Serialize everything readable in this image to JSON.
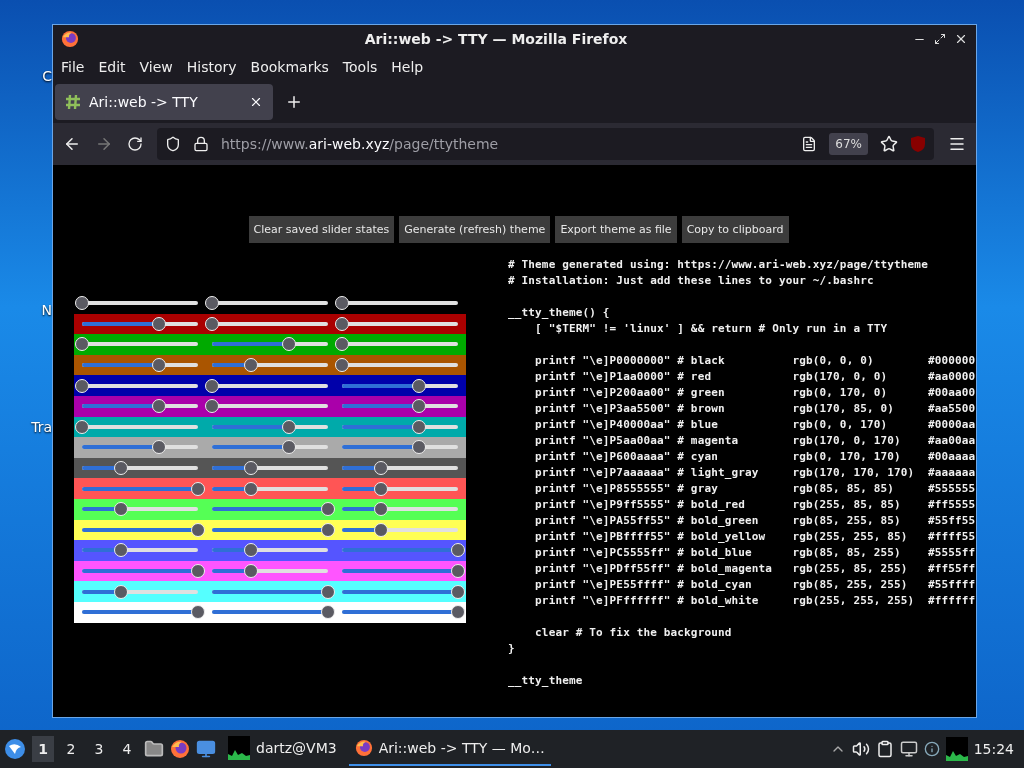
{
  "desktop_labels": [
    "C",
    "N",
    "Tra"
  ],
  "window": {
    "title": "Ari::web -> TTY — Mozilla Firefox"
  },
  "menu": [
    "File",
    "Edit",
    "View",
    "History",
    "Bookmarks",
    "Tools",
    "Help"
  ],
  "tabs": [
    {
      "label": "Ari::web -> TTY",
      "selected": true
    }
  ],
  "address": {
    "prefix": "https://www.",
    "domain": "ari-web.xyz",
    "path": "/page/ttytheme",
    "zoom": "67%"
  },
  "buttons": [
    "Clear saved slider states",
    "Generate (refresh) theme",
    "Export theme as file",
    "Copy to clipboard"
  ],
  "swatches": [
    {
      "color": "#000000",
      "sliders": [
        {
          "level": 0
        },
        {
          "level": 0
        },
        {
          "level": 0
        }
      ]
    },
    {
      "color": "#aa0000",
      "sliders": [
        {
          "level": 0.667
        },
        {
          "level": 0
        },
        {
          "level": 0
        }
      ]
    },
    {
      "color": "#00aa00",
      "sliders": [
        {
          "level": 0
        },
        {
          "level": 0.667
        },
        {
          "level": 0
        }
      ]
    },
    {
      "color": "#aa5500",
      "sliders": [
        {
          "level": 0.667
        },
        {
          "level": 0.333
        },
        {
          "level": 0
        }
      ]
    },
    {
      "color": "#0000aa",
      "sliders": [
        {
          "level": 0
        },
        {
          "level": 0
        },
        {
          "level": 0.667
        }
      ]
    },
    {
      "color": "#aa00aa",
      "sliders": [
        {
          "level": 0.667
        },
        {
          "level": 0
        },
        {
          "level": 0.667
        }
      ]
    },
    {
      "color": "#00aaaa",
      "sliders": [
        {
          "level": 0
        },
        {
          "level": 0.667
        },
        {
          "level": 0.667
        }
      ]
    },
    {
      "color": "#aaaaaa",
      "sliders": [
        {
          "level": 0.667
        },
        {
          "level": 0.667
        },
        {
          "level": 0.667
        }
      ]
    },
    {
      "color": "#555555",
      "sliders": [
        {
          "level": 0.333
        },
        {
          "level": 0.333
        },
        {
          "level": 0.333
        }
      ]
    },
    {
      "color": "#ff5555",
      "sliders": [
        {
          "level": 1
        },
        {
          "level": 0.333
        },
        {
          "level": 0.333
        }
      ]
    },
    {
      "color": "#55ff55",
      "sliders": [
        {
          "level": 0.333
        },
        {
          "level": 1
        },
        {
          "level": 0.333
        }
      ]
    },
    {
      "color": "#ffff55",
      "sliders": [
        {
          "level": 1
        },
        {
          "level": 1
        },
        {
          "level": 0.333
        }
      ]
    },
    {
      "color": "#5555ff",
      "sliders": [
        {
          "level": 0.333
        },
        {
          "level": 0.333
        },
        {
          "level": 1
        }
      ]
    },
    {
      "color": "#ff55ff",
      "sliders": [
        {
          "level": 1
        },
        {
          "level": 0.333
        },
        {
          "level": 1
        }
      ]
    },
    {
      "color": "#55ffff",
      "sliders": [
        {
          "level": 0.333
        },
        {
          "level": 1
        },
        {
          "level": 1
        }
      ]
    },
    {
      "color": "#ffffff",
      "sliders": [
        {
          "level": 1
        },
        {
          "level": 1
        },
        {
          "level": 1
        }
      ]
    }
  ],
  "code_blocks": [
    [
      "# Theme generated using: https://www.ari-web.xyz/page/ttytheme",
      "# Installation: Just add these lines to your ~/.bashrc"
    ],
    [
      "__tty_theme() {",
      "    [ \"$TERM\" != 'linux' ] && return # Only run in a TTY"
    ],
    [
      "    printf \"\\e]P0000000\" # black          rgb(0, 0, 0)        #000000",
      "    printf \"\\e]P1aa0000\" # red            rgb(170, 0, 0)      #aa0000",
      "    printf \"\\e]P200aa00\" # green          rgb(0, 170, 0)      #00aa00",
      "    printf \"\\e]P3aa5500\" # brown          rgb(170, 85, 0)     #aa5500",
      "    printf \"\\e]P40000aa\" # blue           rgb(0, 0, 170)      #0000aa",
      "    printf \"\\e]P5aa00aa\" # magenta        rgb(170, 0, 170)    #aa00aa",
      "    printf \"\\e]P600aaaa\" # cyan           rgb(0, 170, 170)    #00aaaa",
      "    printf \"\\e]P7aaaaaa\" # light_gray     rgb(170, 170, 170)  #aaaaaa",
      "    printf \"\\e]P8555555\" # gray           rgb(85, 85, 85)     #555555",
      "    printf \"\\e]P9ff5555\" # bold_red       rgb(255, 85, 85)    #ff5555",
      "    printf \"\\e]PA55ff55\" # bold_green     rgb(85, 255, 85)    #55ff55",
      "    printf \"\\e]PBffff55\" # bold_yellow    rgb(255, 255, 85)   #ffff55",
      "    printf \"\\e]PC5555ff\" # bold_blue      rgb(85, 85, 255)    #5555ff",
      "    printf \"\\e]PDff55ff\" # bold_magenta   rgb(255, 85, 255)   #ff55ff",
      "    printf \"\\e]PE55ffff\" # bold_cyan      rgb(85, 255, 255)   #55ffff",
      "    printf \"\\e]PFffffff\" # bold_white     rgb(255, 255, 255)  #ffffff"
    ],
    [
      "    clear # To fix the background",
      "}"
    ],
    [
      "__tty_theme"
    ]
  ],
  "taskbar": {
    "workspaces": [
      {
        "label": "1",
        "selected": true
      },
      {
        "label": "2",
        "selected": false
      },
      {
        "label": "3",
        "selected": false
      },
      {
        "label": "4",
        "selected": false
      }
    ],
    "tasks": [
      {
        "label": "dartz@VM3",
        "kind": "terminal",
        "selected": false
      },
      {
        "label": "Ari::web -> TTY — Mo…",
        "kind": "browser",
        "selected": true
      }
    ],
    "clock": "15:24"
  }
}
